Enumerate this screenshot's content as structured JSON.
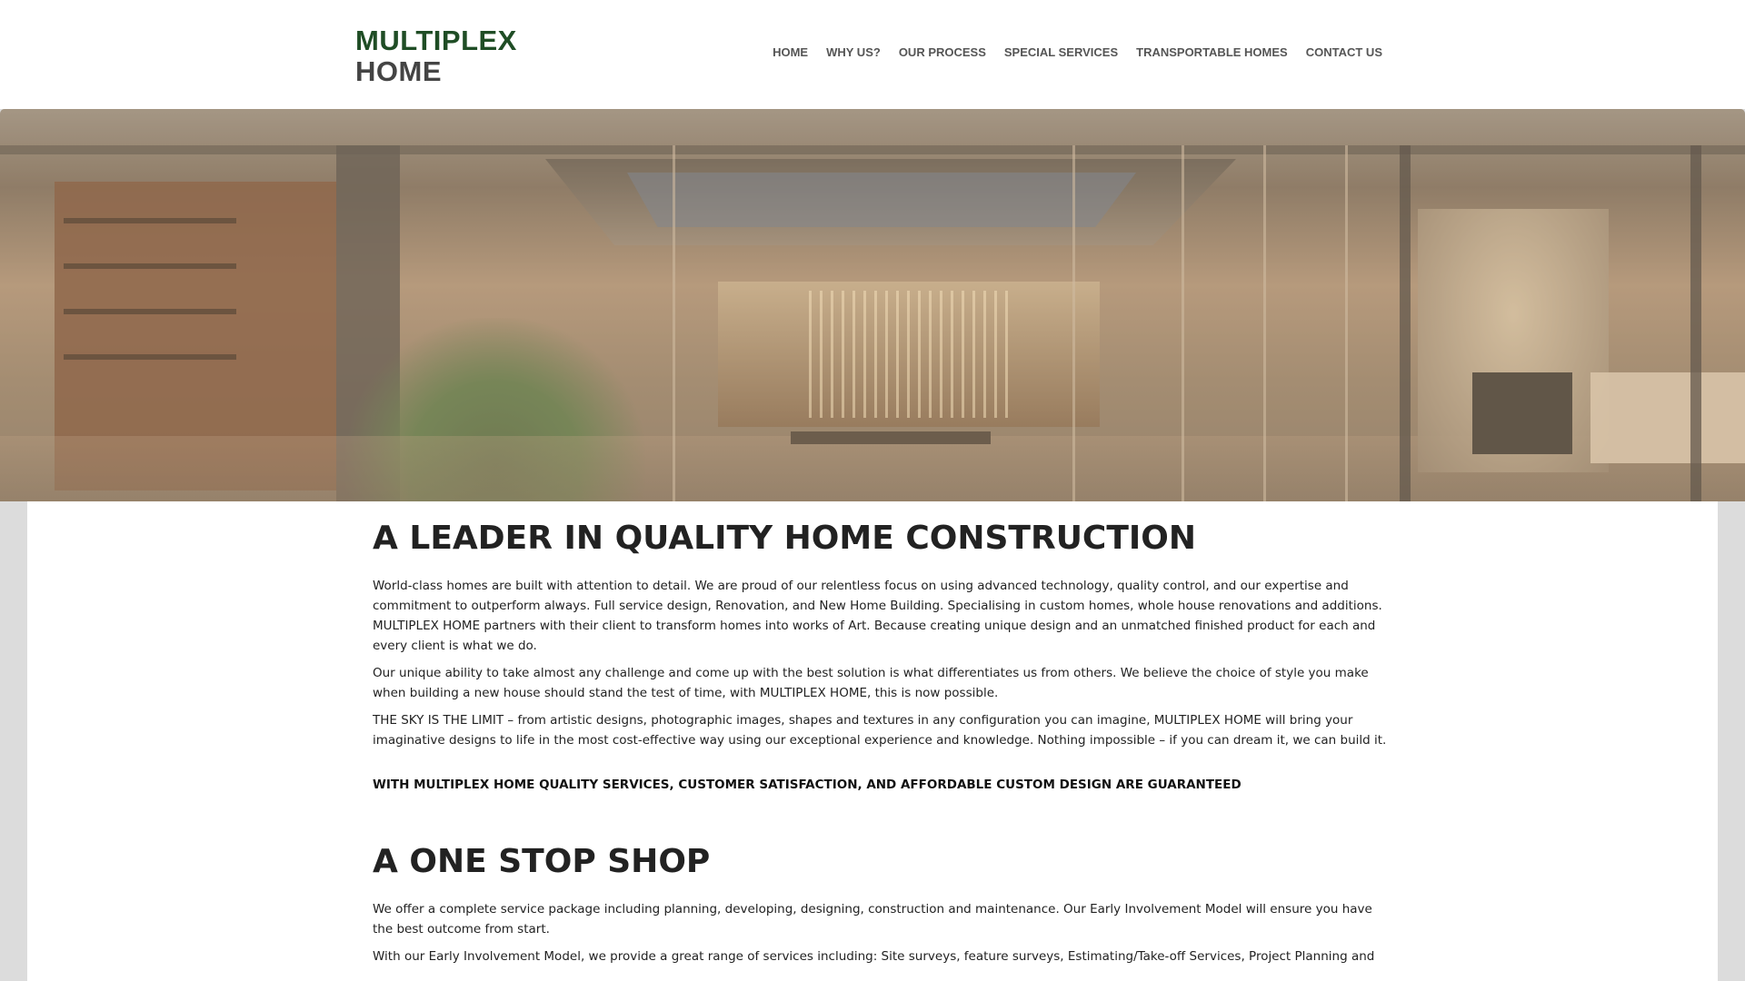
{
  "header": {
    "logo_line1": "MULTIPLEX",
    "logo_line2": "HOME",
    "nav": [
      {
        "label": "HOME"
      },
      {
        "label": "WHY US?"
      },
      {
        "label": "OUR PROCESS"
      },
      {
        "label": "SPECIAL SERVICES"
      },
      {
        "label": "TRANSPORTABLE HOMES"
      },
      {
        "label": "CONTACT US"
      }
    ]
  },
  "main": {
    "heading1": "A LEADER IN QUALITY HOME CONSTRUCTION",
    "paragraphs1": [
      "World-class homes are built with attention to detail. We are proud of our relentless focus on using advanced technology, quality control, and our expertise and commitment to outperform always. Full service design, Renovation, and New Home Building. Specialising in custom homes, whole house renovations and additions. MULTIPLEX HOME partners with their client to transform homes into works of Art. Because creating unique design and an unmatched finished product for each and every client is what we do.",
      "Our unique ability to take almost any challenge and come up with the best solution is what differentiates us from others. We believe the choice of style you make when building a new house should stand the test of time, with MULTIPLEX HOME, this is now possible.",
      "THE SKY IS THE LIMIT – from artistic designs, photographic images, shapes and textures in any configuration you can imagine, MULTIPLEX HOME will bring your imaginative designs to life in the most cost-effective way using our exceptional experience and knowledge. Nothing impossible – if you can dream it, we can build it."
    ],
    "guarantee": "WITH MULTIPLEX HOME QUALITY SERVICES, CUSTOMER SATISFACTION, AND AFFORDABLE CUSTOM DESIGN ARE GUARANTEED",
    "heading2": "A ONE STOP SHOP",
    "paragraphs2": [
      "We offer a complete service package including planning, developing, designing, construction and maintenance. Our Early Involvement Model will ensure you have the best outcome from start.",
      "With our Early Involvement Model, we provide a great range of services including: Site surveys, feature surveys, Estimating/Take-off Services, Project Planning and"
    ]
  },
  "colors": {
    "logo_green": "#1f4d25",
    "logo_gray": "#444444",
    "nav_text": "#555555",
    "body_text": "#222222"
  }
}
